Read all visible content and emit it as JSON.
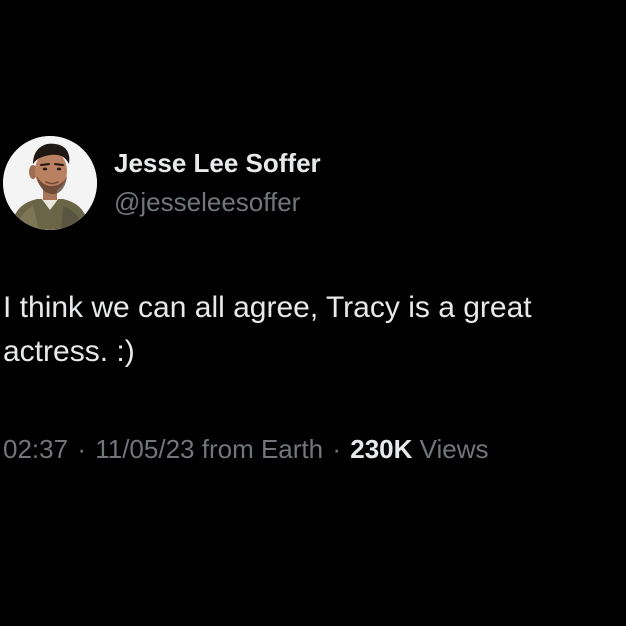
{
  "author": {
    "display_name": "Jesse Lee Soffer",
    "handle": "@jesseleesoffer",
    "avatar_icon": "profile-photo"
  },
  "tweet": {
    "text_lines": [
      "I think we can all agree, Tracy is a great",
      "actress. :)"
    ]
  },
  "meta": {
    "time": "02:37",
    "separator": "·",
    "date": "11/05/23",
    "source": "from Earth",
    "views_count": "230K",
    "views_label": "Views"
  },
  "colors": {
    "background": "#000000",
    "primary_text": "#e7e9ea",
    "secondary_text": "#71767b"
  }
}
